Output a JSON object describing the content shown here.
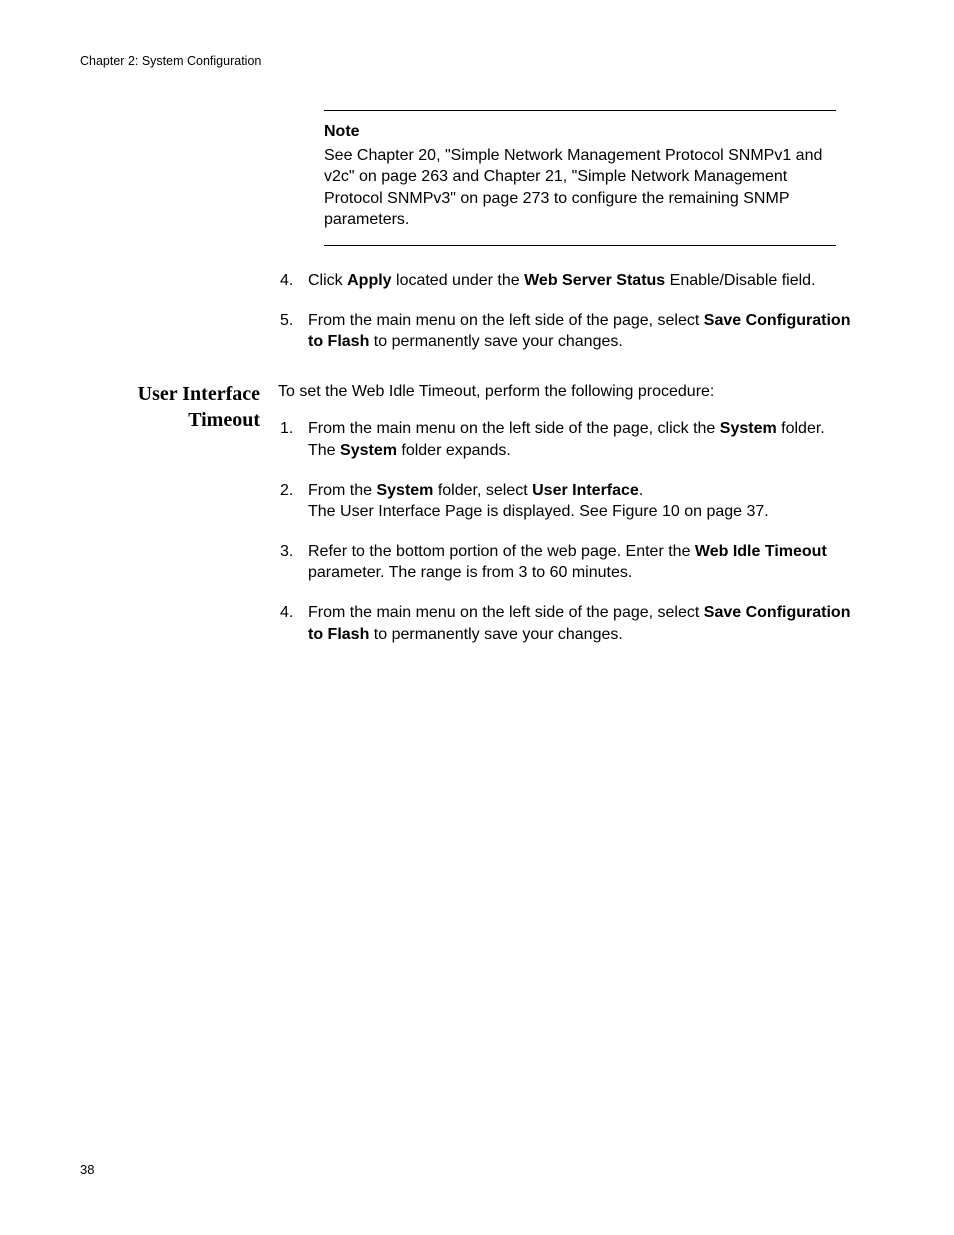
{
  "header": "Chapter 2: System Configuration",
  "note": {
    "title": "Note",
    "body_pre": "See Chapter 20, \"Simple Network Management Protocol SNMPv1 and v2c\" on page 263 and Chapter 21, \"Simple Network Management Protocol SNMPv3\" on page 273 to configure the remaining SNMP parameters."
  },
  "steps_a": {
    "s4": {
      "num": "4.",
      "t1": "Click ",
      "b1": "Apply",
      "t2": " located under the ",
      "b2": "Web Server Status",
      "t3": " Enable/Disable field."
    },
    "s5": {
      "num": "5.",
      "t1": "From the main menu on the left side of the page, select ",
      "b1": "Save Configuration to Flash",
      "t2": " to permanently save your changes."
    }
  },
  "section": {
    "heading_l1": "User Interface",
    "heading_l2": "Timeout",
    "intro": "To set the Web Idle Timeout, perform the following procedure:"
  },
  "steps_b": {
    "s1": {
      "num": "1.",
      "t1": "From the main menu on the left side of the page, click the ",
      "b1": "System",
      "t2": " folder.",
      "t3": "The ",
      "b2": "System",
      "t4": " folder expands."
    },
    "s2": {
      "num": "2.",
      "t1": "From the ",
      "b1": "System",
      "t2": " folder, select ",
      "b2": "User Interface",
      "t3": ".",
      "t4": "The User Interface Page is displayed. See Figure 10 on page 37."
    },
    "s3": {
      "num": "3.",
      "t1": "Refer to the bottom portion of the web page. Enter the ",
      "b1": "Web Idle Timeout",
      "t2": " parameter. The range is from 3 to 60 minutes."
    },
    "s4": {
      "num": "4.",
      "t1": "From the main menu on the left side of the page, select ",
      "b1": "Save Configuration to Flash",
      "t2": " to permanently save your changes."
    }
  },
  "page_number": "38"
}
